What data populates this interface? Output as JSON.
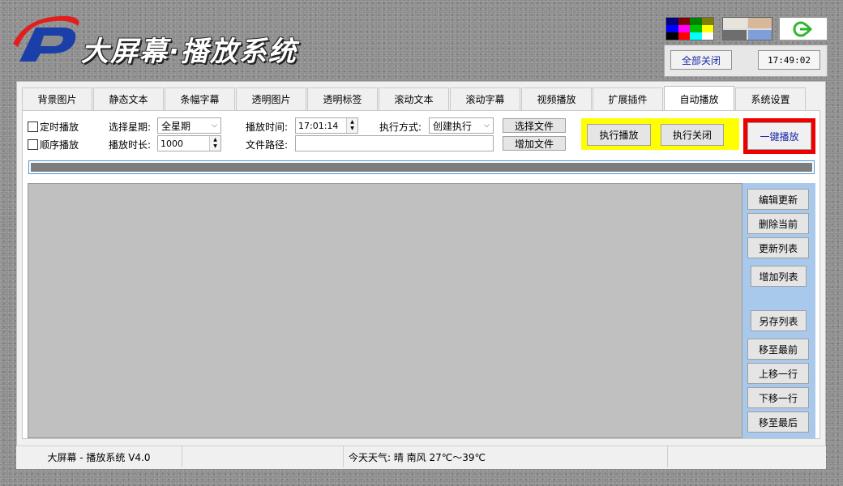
{
  "header": {
    "app_title": "大屏幕·播放系统",
    "close_all_label": "全部关闭",
    "clock": "17:49:02",
    "color_swatches": [
      "#000080",
      "#800000",
      "#008000",
      "#808000",
      "#0000ff",
      "#ff00ff",
      "#00c000",
      "#ffff00",
      "#000000",
      "#ff0000",
      "#00ffff",
      "#ffffff"
    ],
    "texture_swatches": [
      "#e8e4dc",
      "#d8b89a",
      "#6e6e6e",
      "#7f9fd8"
    ],
    "exit_icon_color": "#2eb82e"
  },
  "tabs": [
    {
      "label": "背景图片"
    },
    {
      "label": "静态文本"
    },
    {
      "label": "条幅字幕"
    },
    {
      "label": "透明图片"
    },
    {
      "label": "透明标签"
    },
    {
      "label": "滚动文本"
    },
    {
      "label": "滚动字幕"
    },
    {
      "label": "视频播放"
    },
    {
      "label": "扩展插件"
    },
    {
      "label": "自动播放",
      "active": true
    },
    {
      "label": "系统设置"
    }
  ],
  "form": {
    "timed_play_label": "定时播放",
    "seq_play_label": "顺序播放",
    "weekday_label": "选择星期:",
    "weekday_value": "全星期",
    "duration_label": "播放时长:",
    "duration_value": "1000",
    "play_time_label": "播放时间:",
    "play_time_value": "17:01:14",
    "file_path_label": "文件路径:",
    "file_path_value": "",
    "exec_mode_label": "执行方式:",
    "exec_mode_value": "创建执行",
    "select_file_label": "选择文件",
    "add_file_label": "增加文件",
    "exec_play_label": "执行播放",
    "exec_close_label": "执行关闭",
    "one_key_play_label": "一键播放"
  },
  "progress": {
    "value": 1.0
  },
  "side_buttons": {
    "edit_update": "编辑更新",
    "delete_current": "删除当前",
    "update_list": "更新列表",
    "add_list": "增加列表",
    "save_as_list": "另存列表",
    "move_first": "移至最前",
    "move_up": "上移一行",
    "move_down": "下移一行",
    "move_last": "移至最后"
  },
  "status": {
    "version": "大屏幕 - 播放系统 V4.0",
    "weather": "今天天气: 晴 南风 27℃～39℃"
  }
}
